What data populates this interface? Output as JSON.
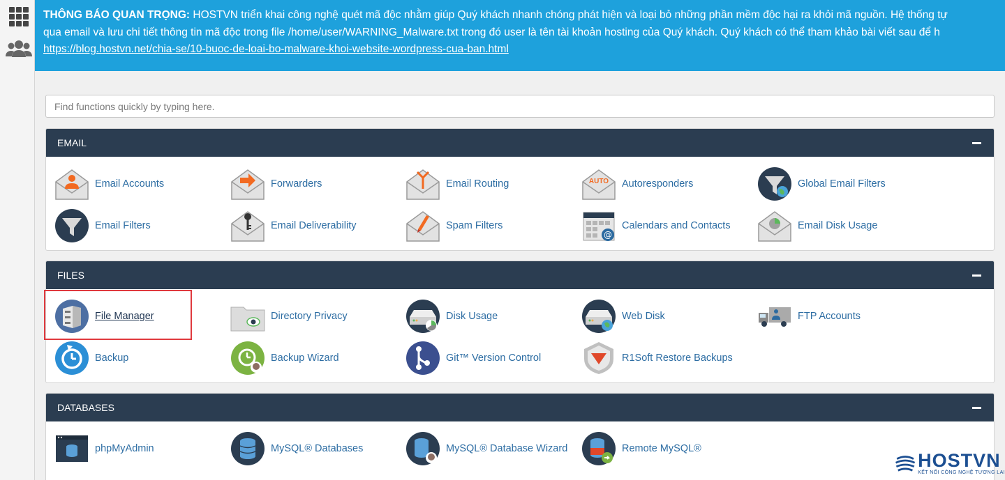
{
  "notice": {
    "title": "THÔNG BÁO QUAN TRỌNG:",
    "line1": " HOSTVN triển khai công nghệ quét mã độc nhằm giúp Quý khách nhanh chóng phát hiện và loại bỏ những phần mềm độc hại ra khỏi mã nguồn. Hệ thống tự",
    "line2": "qua email và lưu chi tiết thông tin mã độc trong file /home/user/WARNING_Malware.txt trong đó user là tên tài khoản hosting của Quý khách. Quý khách có thể tham khảo bài viết sau để h",
    "link": "https://blog.hostvn.net/chia-se/10-buoc-de-loai-bo-malware-khoi-website-wordpress-cua-ban.html"
  },
  "search": {
    "placeholder": "Find functions quickly by typing here."
  },
  "sections": {
    "email": {
      "title": "EMAIL",
      "items": [
        "Email Accounts",
        "Forwarders",
        "Email Routing",
        "Autoresponders",
        "Global Email Filters",
        "Email Filters",
        "Email Deliverability",
        "Spam Filters",
        "Calendars and Contacts",
        "Email Disk Usage"
      ]
    },
    "files": {
      "title": "FILES",
      "items": [
        "File Manager",
        "Directory Privacy",
        "Disk Usage",
        "Web Disk",
        "FTP Accounts",
        "Backup",
        "Backup Wizard",
        "Git™ Version Control",
        "R1Soft Restore Backups"
      ]
    },
    "databases": {
      "title": "DATABASES",
      "items": [
        "phpMyAdmin",
        "MySQL® Databases",
        "MySQL® Database Wizard",
        "Remote MySQL®"
      ]
    }
  },
  "icons": {
    "email": [
      "email-accounts-icon",
      "forwarders-icon",
      "email-routing-icon",
      "autoresponders-icon",
      "global-email-filters-icon",
      "email-filters-icon",
      "email-deliverability-icon",
      "spam-filters-icon",
      "calendars-contacts-icon",
      "email-disk-usage-icon"
    ],
    "files": [
      "file-manager-icon",
      "directory-privacy-icon",
      "disk-usage-icon",
      "web-disk-icon",
      "ftp-accounts-icon",
      "backup-icon",
      "backup-wizard-icon",
      "git-version-control-icon",
      "r1soft-restore-icon"
    ],
    "databases": [
      "phpmyadmin-icon",
      "mysql-databases-icon",
      "mysql-database-wizard-icon",
      "remote-mysql-icon"
    ]
  },
  "autoresponder_badge": "AUTO",
  "brand": {
    "name": "HOSTVN",
    "tagline": "KẾT NỐI CÔNG NGHỆ TƯƠNG LAI"
  },
  "colors": {
    "notice_bg": "#1ea1dc",
    "header_bg": "#2b3d51",
    "link": "#2d6da3",
    "highlight": "#e0393e"
  }
}
